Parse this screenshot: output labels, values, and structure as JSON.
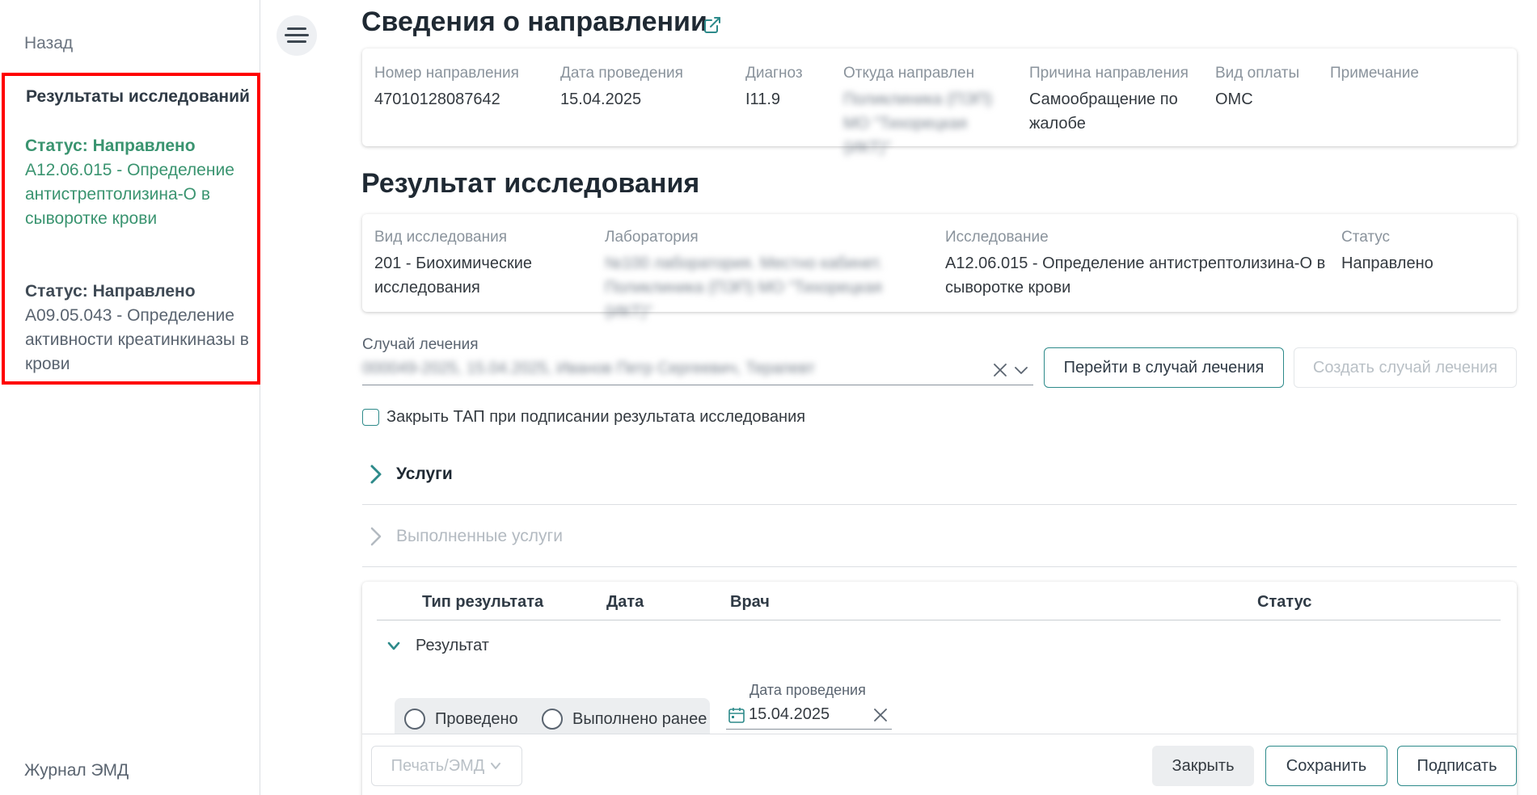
{
  "sidebar": {
    "back_label": "Назад",
    "nav_title": "Результаты исследований",
    "items": [
      {
        "status": "Статус: Направлено",
        "desc": "A12.06.015 - Определение антистрептолизина-О в сыворотке крови",
        "active": true
      },
      {
        "status": "Статус: Направлено",
        "desc": "A09.05.043 - Определение активности креатинкиназы в крови",
        "active": false
      }
    ],
    "journal_label": "Журнал ЭМД"
  },
  "referral": {
    "title": "Сведения о направлении",
    "fields": {
      "number": {
        "label": "Номер направления",
        "value": "47010128087642"
      },
      "date": {
        "label": "Дата проведения",
        "value": "15.04.2025"
      },
      "diagnosis": {
        "label": "Диагноз",
        "value": "I11.9"
      },
      "from": {
        "label": "Откуда направлен",
        "value": "Поликлиника (ПЭП) МО \"Тихорецкая (ИКТ)\""
      },
      "reason": {
        "label": "Причина направления",
        "value": "Самообращение по жалобе"
      },
      "payment": {
        "label": "Вид оплаты",
        "value": "ОМС"
      },
      "note": {
        "label": "Примечание",
        "value": ""
      }
    }
  },
  "study": {
    "title": "Результат исследования",
    "fields": {
      "type": {
        "label": "Вид исследования",
        "value": "201 - Биохимические исследования"
      },
      "lab": {
        "label": "Лаборатория",
        "value": "№100 лаборатория. Местно кабинет. Поликлиника (ПЭП) МО \"Тихорецкая (ИКТ)\""
      },
      "research": {
        "label": "Исследование",
        "value": "A12.06.015 - Определение антистрептолизина-О в сыворотке крови"
      },
      "status": {
        "label": "Статус",
        "value": "Направлено"
      }
    }
  },
  "treatment_case": {
    "label": "Случай лечения",
    "value": "000049-2025, 15.04.2025, Иванов Петр Сергеевич, Терапевт",
    "goto_button": "Перейти в случай лечения",
    "create_button": "Создать случай лечения"
  },
  "close_tap_checkbox": {
    "label": "Закрыть ТАП при подписании результата исследования",
    "checked": false
  },
  "sections": {
    "services": "Услуги",
    "done_services": "Выполненные услуги"
  },
  "results_table": {
    "headers": [
      "Тип результата",
      "Дата",
      "Врач",
      "Статус"
    ],
    "row_label": "Результат",
    "radio_done": "Проведено",
    "radio_earlier": "Выполнено ранее",
    "date_label": "Дата проведения",
    "date_value": "15.04.2025"
  },
  "footer": {
    "print": "Печать/ЭМД",
    "close": "Закрыть",
    "save": "Сохранить",
    "sign": "Подписать"
  },
  "colors": {
    "accent": "#2d8a8a",
    "active_nav": "#3a9470",
    "highlight_box": "#ff0000"
  }
}
